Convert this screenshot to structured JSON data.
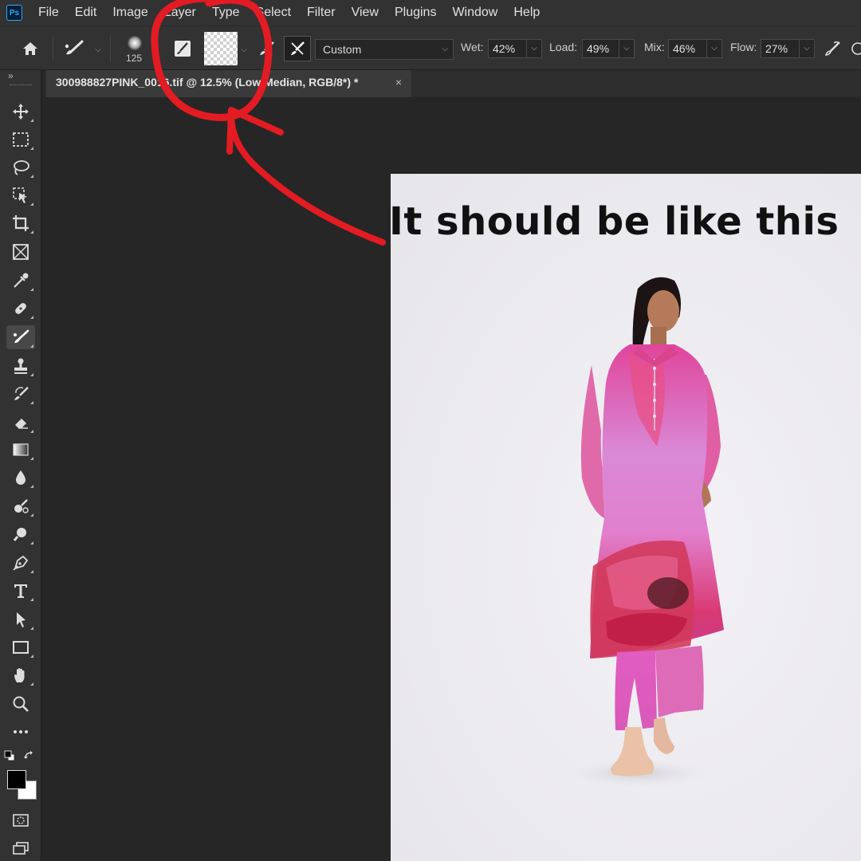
{
  "app": {
    "logo": "Ps"
  },
  "menu": [
    "File",
    "Edit",
    "Image",
    "Layer",
    "Type",
    "Select",
    "Filter",
    "View",
    "Plugins",
    "Window",
    "Help"
  ],
  "options": {
    "brush_size": "125",
    "preset": "Custom",
    "wet_label": "Wet:",
    "wet_value": "42%",
    "load_label": "Load:",
    "load_value": "49%",
    "mix_label": "Mix:",
    "mix_value": "46%",
    "flow_label": "Flow:",
    "flow_value": "27%"
  },
  "document": {
    "tab_title": "300988827PINK_0016.tif @ 12.5% (Low Median, RGB/8*) *",
    "close_glyph": "×"
  },
  "annotation": {
    "text": "It should be like this",
    "color": "#e31b23"
  },
  "toolbar": {
    "tools": [
      "move-tool",
      "marquee-tool",
      "lasso-tool",
      "object-selection-tool",
      "crop-tool",
      "frame-tool",
      "eyedropper-tool",
      "healing-brush-tool",
      "mixer-brush-tool",
      "clone-stamp-tool",
      "history-brush-tool",
      "eraser-tool",
      "gradient-tool",
      "blur-tool",
      "dodge-tool",
      "zoom-in-tool",
      "pen-tool",
      "type-tool",
      "path-selection-tool",
      "rectangle-tool",
      "hand-tool",
      "zoom-tool",
      "more-tools",
      "quick-mask",
      "screen-mode"
    ],
    "foreground_color": "#000000",
    "background_color": "#ffffff"
  }
}
